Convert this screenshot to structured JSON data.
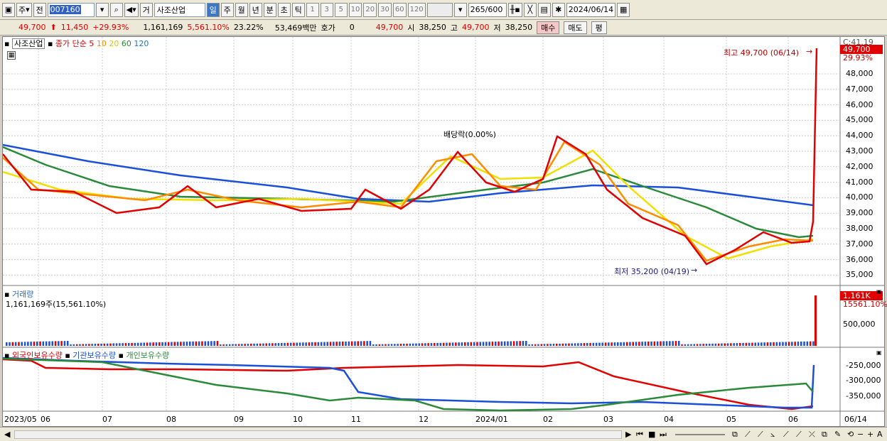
{
  "toolbar": {
    "type_label": "주",
    "prev_label": "전",
    "stock_code": "007160",
    "exchange_label": "거",
    "stock_name": "사조산업",
    "periods": [
      "일",
      "주",
      "월",
      "년",
      "분",
      "초",
      "틱"
    ],
    "interval_numbers": [
      "1",
      "3",
      "5",
      "10",
      "20",
      "30",
      "60",
      "120"
    ],
    "bar_count": "265",
    "bar_total": "/600",
    "date": "2024/06/14"
  },
  "quote": {
    "price": "49,700",
    "change": "11,450",
    "change_pct": "+29.93%",
    "volume": "1,161,169",
    "volume_ratio": "5,561.10%",
    "turnover": "23.22%",
    "amount": "53,469백만",
    "hoga_label": "호가",
    "hoga_value": "0",
    "hoga_price": "49,700",
    "open_label": "시",
    "open": "38,250",
    "high_label": "고",
    "high": "49,700",
    "low_label": "저",
    "low": "38,250",
    "buy_label": "매수",
    "sell_label": "매도",
    "eval_label": "평"
  },
  "price_panel": {
    "legend_name": "사조산업",
    "legend_ma": "종가 단순",
    "ma_periods": [
      "5",
      "10",
      "20",
      "60",
      "120"
    ],
    "ma_colors": [
      "#e00000",
      "#ff8c00",
      "#f0e000",
      "#2a8a3a",
      "#1a4fd8"
    ],
    "high_annotation": "최고 49,700 (06/14)",
    "low_annotation": "최저 35,200 (04/19)",
    "dividend_annotation": "배당락(0.00%)",
    "scale_top": "C:41.19",
    "price_tag": "49,700",
    "pct_tag": "29.93%",
    "ticks": [
      "48,000",
      "47,000",
      "46,000",
      "45,000",
      "44,000",
      "43,000",
      "42,000",
      "41,000",
      "40,000",
      "39,000",
      "38,000",
      "37,000",
      "36,000",
      "35,000"
    ]
  },
  "volume_panel": {
    "title": "거래량",
    "value_text": "1,161,169주(15,561.10%)",
    "tag": "1,161K",
    "tag_pct": "15561.10%",
    "tick": "500,000"
  },
  "holdings_panel": {
    "legend": [
      "외국인보유수량",
      "기관보유수량",
      "개인보유수량"
    ],
    "ticks": [
      "-250,000",
      "-300,000",
      "-350,000"
    ]
  },
  "x_axis": [
    "2023/05",
    "06",
    "07",
    "08",
    "09",
    "10",
    "11",
    "12",
    "2024/01",
    "02",
    "03",
    "04",
    "05",
    "06"
  ],
  "x_right_label": "06/14"
}
